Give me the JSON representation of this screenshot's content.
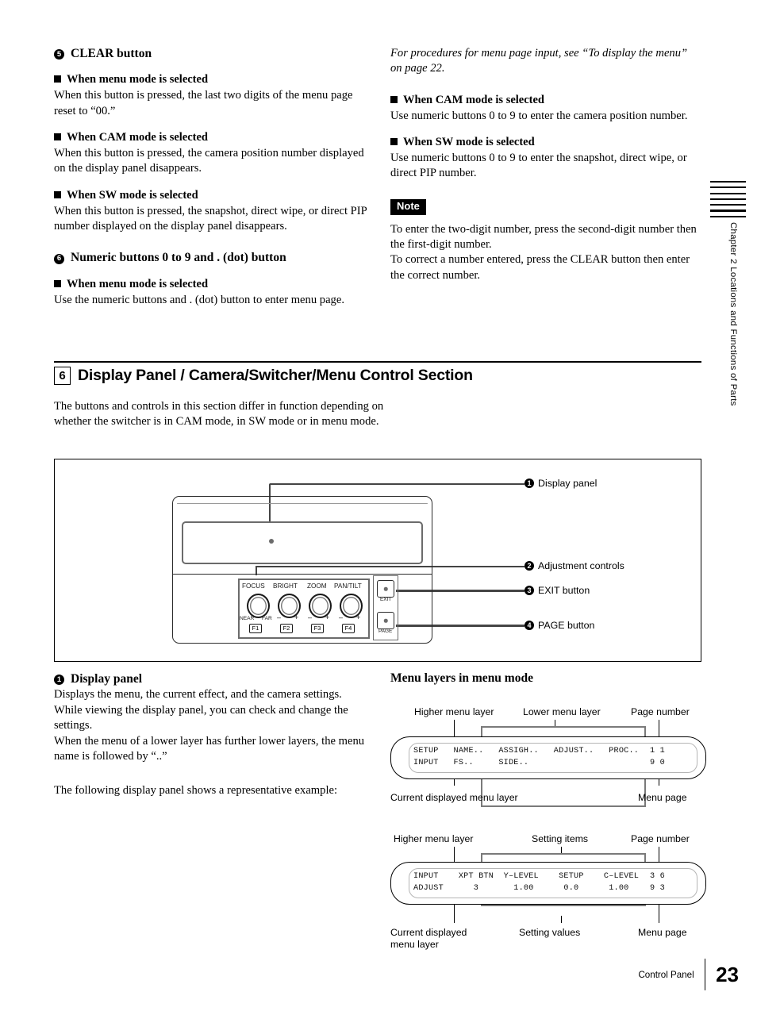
{
  "left_column": {
    "item5": {
      "number": "5",
      "title": "CLEAR button",
      "blocks": [
        {
          "head": "When menu mode is selected",
          "body": "When this button is pressed, the last two digits of the menu page reset to “00.”"
        },
        {
          "head": "When CAM mode is selected",
          "body": "When this button is pressed, the camera position number displayed on the display panel disappears."
        },
        {
          "head": "When SW mode is selected",
          "body": "When this button is pressed, the snapshot, direct wipe, or direct PIP number displayed on the display panel disappears."
        }
      ]
    },
    "item6": {
      "number": "6",
      "title": "Numeric buttons 0 to 9 and . (dot) button",
      "blocks": [
        {
          "head": "When menu mode is selected",
          "body": "Use the numeric buttons and . (dot) button to enter menu page."
        }
      ]
    }
  },
  "right_column": {
    "italic_ref": "For procedures for menu page input, see “To display the menu” on page 22.",
    "blocks": [
      {
        "head": "When CAM mode is selected",
        "body": "Use numeric buttons 0 to 9 to enter the camera position number."
      },
      {
        "head": "When SW mode is selected",
        "body": "Use numeric buttons 0 to 9 to enter the snapshot, direct wipe, or direct PIP number."
      }
    ],
    "note": {
      "badge": "Note",
      "line1": "To enter the two-digit number, press the second-digit number then the first-digit number.",
      "line2": "To correct a number entered, press the CLEAR button then enter the correct number."
    }
  },
  "section6": {
    "number": "6",
    "title": "Display Panel / Camera/Switcher/Menu Control Section",
    "body": "The buttons and controls in this section differ in function depending on whether the switcher is in CAM mode, in SW mode or in menu mode."
  },
  "figure": {
    "callouts": [
      {
        "num": "1",
        "label": "Display panel"
      },
      {
        "num": "2",
        "label": "Adjustment controls"
      },
      {
        "num": "3",
        "label": "EXIT button"
      },
      {
        "num": "4",
        "label": "PAGE button"
      }
    ],
    "device": {
      "knob_labels": [
        "FOCUS",
        "BRIGHT",
        "ZOOM",
        "PAN/TILT"
      ],
      "focus_min": "NEAR",
      "focus_max": "FAR",
      "minus": "–",
      "plus": "+",
      "function_keys": [
        "F1",
        "F2",
        "F3",
        "F4"
      ],
      "exit_label": "EXIT",
      "page_label": "PAGE"
    }
  },
  "display_panel_desc": {
    "number": "1",
    "title": "Display panel",
    "p1": "Displays the menu, the current effect, and the camera settings.",
    "p2": "While viewing the display panel, you can check and change the settings.",
    "p3": "When the menu of a lower layer has further lower layers, the menu name is followed by “..”",
    "p4": "The following display panel shows a representative example:"
  },
  "menu_layers": {
    "heading": "Menu layers in menu mode",
    "diagram1": {
      "top_labels": [
        "Higher menu layer",
        "Lower menu layer",
        "Page number"
      ],
      "bottom_labels": [
        "Current displayed menu layer",
        "Menu page"
      ],
      "lcd_row1": "SETUP   NAME..   ASSIGH..   ADJUST..   PROC..",
      "lcd_row2": "INPUT   FS..     SIDE..",
      "page_row1": "1 1",
      "page_row2": "9 0"
    },
    "diagram2": {
      "top_labels": [
        "Higher menu layer",
        "Setting items",
        "Page number"
      ],
      "bottom_labels": [
        "Current displayed\nmenu layer",
        "Setting values",
        "Menu page"
      ],
      "lcd_row1": "INPUT    XPT BTN  Y–LEVEL    SETUP    C–LEVEL",
      "lcd_row2": "ADJUST      3       1.00      0.0      1.00",
      "page_row1": "3 6",
      "page_row2": "9 3"
    }
  },
  "margin": {
    "chapter_text": "Chapter 2  Locations and Functions of Parts",
    "tab_line_count": 7
  },
  "footer": {
    "label": "Control Panel",
    "page_number": "23"
  }
}
